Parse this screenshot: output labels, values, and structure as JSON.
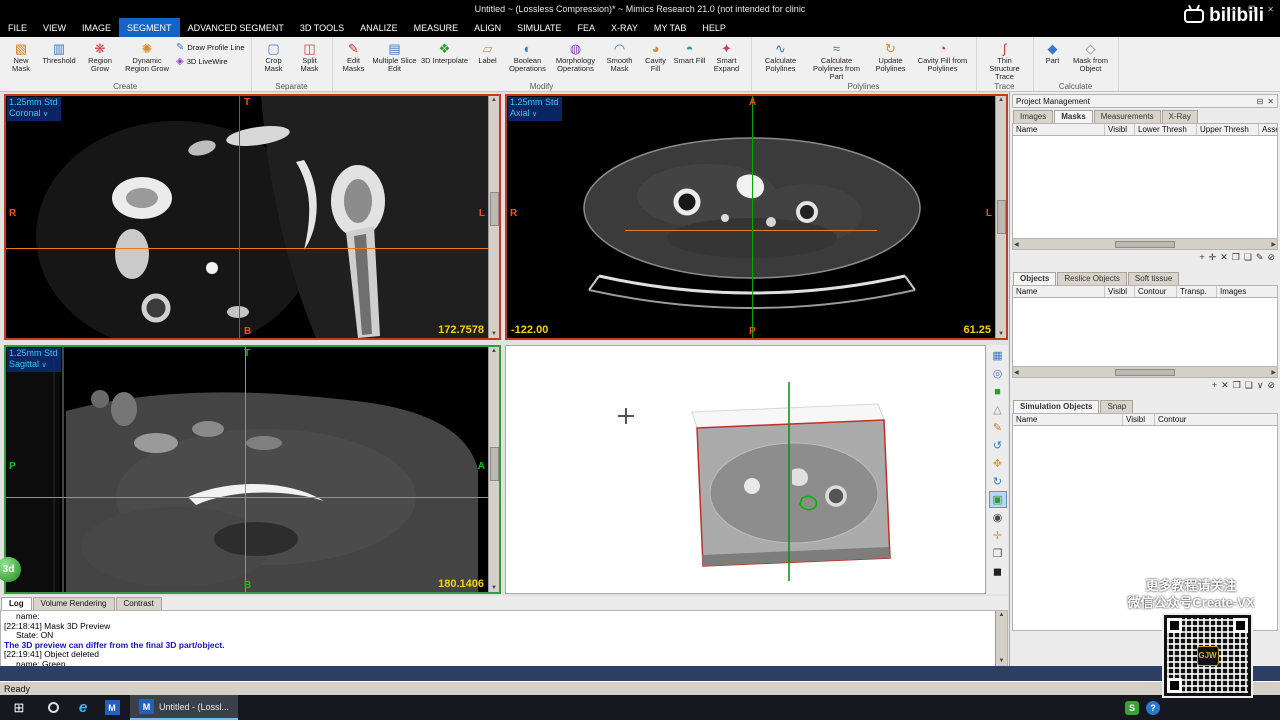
{
  "window": {
    "title": "Untitled ~  (Lossless Compression)* ~ Mimics Research 21.0 (not intended for clinic",
    "controls": {
      "minimize": "─",
      "maximize": "❐",
      "close": "✕"
    },
    "status": "Ready"
  },
  "menu": {
    "items": [
      "FILE",
      "VIEW",
      "IMAGE",
      "SEGMENT",
      "ADVANCED SEGMENT",
      "3D TOOLS",
      "ANALIZE",
      "MEASURE",
      "ALIGN",
      "SIMULATE",
      "FEA",
      "X-RAY",
      "MY TAB",
      "HELP"
    ]
  },
  "ribbon": {
    "group_labels": [
      "Create",
      "Separate",
      "Modify",
      "Polylines",
      "Trace",
      "Calculate"
    ],
    "buttons": {
      "new_mask": "New Mask",
      "threshold": "Threshold",
      "region_grow": "Region Grow",
      "dynamic_region_grow": "Dynamic Region Grow",
      "draw_profile_line": "Draw Profile Line",
      "livewire_3d": "3D LiveWire",
      "crop_mask": "Crop Mask",
      "split_mask": "Split Mask",
      "edit_masks": "Edit Masks",
      "multiple_slice_edit": "Multiple Slice Edit",
      "interpolate_3d": "3D Interpolate",
      "label": "Label",
      "boolean_operations": "Boolean Operations",
      "morphology_operations": "Morphology Operations",
      "smooth_mask": "Smooth Mask",
      "cavity_fill": "Cavity Fill",
      "smart_fill": "Smart Fill",
      "smart_expand": "Smart Expand",
      "calculate_polylines": "Calculate Polylines",
      "calculate_polylines_from_part": "Calculate Polylines from Part",
      "update_polylines": "Update Polylines",
      "cavity_fill_from_polylines": "Cavity Fill from Polylines",
      "thin_structure_trace": "Thin Structure Trace",
      "part": "Part",
      "mask_from_object": "Mask from Object"
    }
  },
  "icons": {
    "new_mask": "▧",
    "threshold": "▥",
    "region_grow": "❋",
    "dynamic_region_grow": "✺",
    "draw_profile_line": "✎",
    "livewire_3d": "◈",
    "crop_mask": "▢",
    "split_mask": "◫",
    "edit_masks": "✎",
    "multiple_slice_edit": "▤",
    "interpolate_3d": "❖",
    "label": "▱",
    "boolean_operations": "◐",
    "morphology_operations": "◍",
    "smooth_mask": "◠",
    "cavity_fill": "◕",
    "smart_fill": "◓",
    "smart_expand": "✦",
    "calculate_polylines": "∿",
    "calculate_polylines_from_part": "≈",
    "update_polylines": "↻",
    "cavity_fill_from_polylines": "◔",
    "thin_structure_trace": "∫",
    "part": "◆",
    "mask_from_object": "◇",
    "dropdown": "∨",
    "strip": [
      "▦",
      "◎",
      "■",
      "△",
      "✎",
      "↺",
      "✥",
      "↻",
      "▣",
      "◉",
      "✛",
      "❐",
      "◼"
    ],
    "pm_actions": [
      "+",
      "✛",
      "✕",
      "❐",
      "❏",
      "✎",
      "⊘"
    ],
    "obj_actions": [
      "+",
      "✕",
      "❐",
      "❏",
      "∨",
      "⊘"
    ],
    "panel_float": "⊟",
    "panel_close": "✕",
    "scroll_up": "▲",
    "scroll_down": "▼",
    "scroll_left": "◀",
    "scroll_right": "▶",
    "start": "⊞",
    "edge": "e",
    "app": "M",
    "tray1": "S",
    "tray2": "?"
  },
  "viewports": {
    "coronal": {
      "res": "1.25mm Std",
      "plane": "Coronal",
      "value": "172.7578",
      "orient": {
        "top": "T",
        "left": "R",
        "bottom": "B",
        "right": "L"
      }
    },
    "axial": {
      "res": "1.25mm Std",
      "plane": "Axial",
      "value_left": "-122.00",
      "value_right": "61.25",
      "orient": {
        "top": "A",
        "left": "R",
        "bottom": "P",
        "right": "L"
      }
    },
    "sagittal": {
      "res": "1.25mm Std",
      "plane": "Sagittal",
      "value": "180.1406",
      "orient": {
        "top": "T",
        "left": "P",
        "bottom": "B",
        "right": "A"
      }
    },
    "badge_3d": "3d"
  },
  "panels": {
    "project_management": {
      "title": "Project Management",
      "tabs": [
        "Images",
        "Masks",
        "Measurements",
        "X-Ray"
      ],
      "columns": [
        "Name",
        "Visibl",
        "Lower Thresh",
        "Upper Thresh",
        "Asse"
      ]
    },
    "objects": {
      "tabs": [
        "Objects",
        "Reslice Objects",
        "Soft tissue"
      ],
      "columns": [
        "Name",
        "Visibl",
        "Contour",
        "Transp.",
        "Images"
      ]
    },
    "simulation": {
      "tabs": [
        "Simulation Objects",
        "Snap"
      ],
      "columns": [
        "Name",
        "Visibl",
        "Contour"
      ]
    }
  },
  "log": {
    "tabs": [
      "Log",
      "Volume Rendering",
      "Contrast"
    ],
    "lines": [
      {
        "text": "name:"
      },
      {
        "text": "[22:18:41] Mask 3D Preview"
      },
      {
        "text": "State: ON"
      },
      {
        "text": "The 3D preview can differ from the final 3D part/object."
      },
      {
        "text": "[22:19:41] Object deleted"
      },
      {
        "text": "name: Green"
      }
    ]
  },
  "taskbar": {
    "window_button": "Untitled - (Lossl..."
  },
  "watermark": {
    "bilibili": "bilibili",
    "line1": "更多教程请关注",
    "line2": "微信公众号Create-VX",
    "qr_logo": "GJW"
  }
}
